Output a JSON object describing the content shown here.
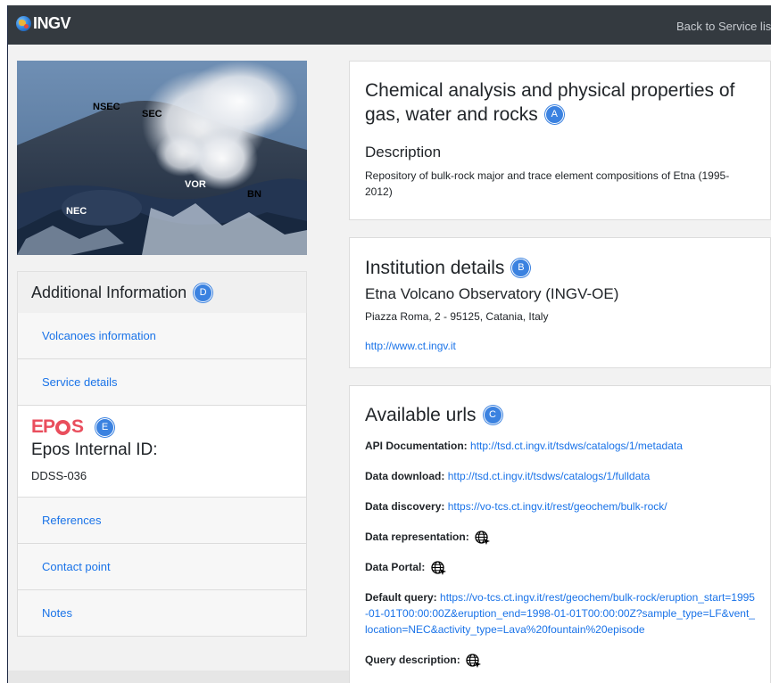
{
  "navbar": {
    "brand": "INGV",
    "back_link": "Back to Service lis"
  },
  "hero_image": {
    "labels": [
      "NSEC",
      "SEC",
      "VOR",
      "BN",
      "NEC"
    ]
  },
  "sidebar": {
    "title": "Additional Information",
    "title_badge": "D",
    "items": [
      {
        "label": "Volcanoes information"
      },
      {
        "label": "Service details"
      }
    ],
    "epos": {
      "badge": "E",
      "logo_left": "EP",
      "logo_right": "S",
      "label": "Epos Internal ID:",
      "value": "DDSS-036"
    },
    "items_after": [
      {
        "label": "References"
      },
      {
        "label": "Contact point"
      },
      {
        "label": "Notes"
      }
    ]
  },
  "main": {
    "card1": {
      "title_line1": "Chemical analysis and physical properties of",
      "title_line2": "gas, water and rocks",
      "badge": "A",
      "desc_title": "Description",
      "desc_text": "Repository of bulk-rock major and trace element compositions of Etna (1995-2012)"
    },
    "card2": {
      "title": "Institution details",
      "badge": "B",
      "institution": "Etna Volcano Observatory (INGV-OE)",
      "address": "Piazza Roma, 2 - 95125, Catania, Italy",
      "website": "http://www.ct.ingv.it"
    },
    "card3": {
      "title": "Available urls",
      "badge": "C",
      "urls": [
        {
          "label": "API Documentation:",
          "value": "http://tsd.ct.ingv.it/tsdws/catalogs/1/metadata"
        },
        {
          "label": "Data download:",
          "value": "http://tsd.ct.ingv.it/tsdws/catalogs/1/fulldata"
        },
        {
          "label": "Data discovery:",
          "value": "https://vo-tcs.ct.ingv.it/rest/geochem/bulk-rock/"
        },
        {
          "label": "Data representation:",
          "value": ""
        },
        {
          "label": "Data Portal:",
          "value": ""
        },
        {
          "label": "Default query:",
          "value": "https://vo-tcs.ct.ingv.it/rest/geochem/bulk-rock/eruption_start=1995-01-01T00:00:00Z&eruption_end=1998-01-01T00:00:00Z?sample_type=LF&vent_location=NEC&activity_type=Lava%20fountain%20episode"
        },
        {
          "label": "Query description:",
          "value": ""
        }
      ]
    }
  },
  "colors": {
    "navbar": "#343a40",
    "link": "#1a73e8",
    "badge": "#3b82e0",
    "epos": "#e94e5d"
  }
}
